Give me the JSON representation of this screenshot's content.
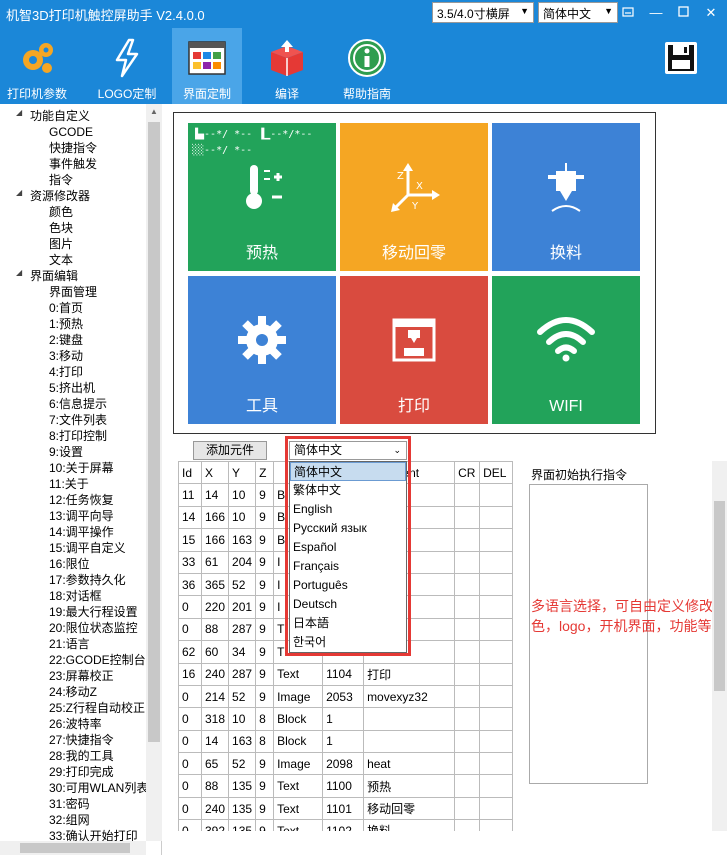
{
  "window": {
    "title": "机智3D打印机触控屏助手 V2.4.0.0",
    "screen_select": "3.5/4.0寸横屏",
    "lang_select": "简体中文",
    "buttons": [
      "minimize",
      "maximize",
      "close"
    ]
  },
  "toolbar": [
    {
      "label": "打印机参数",
      "icon": "gears-icon"
    },
    {
      "label": "LOGO定制",
      "icon": "lightning-icon"
    },
    {
      "label": "界面定制",
      "icon": "layout-icon",
      "active": true
    },
    {
      "label": "编译",
      "icon": "package-icon"
    },
    {
      "label": "帮助指南",
      "icon": "info-icon"
    },
    {
      "label": "",
      "icon": "save-icon"
    }
  ],
  "tree": {
    "items": [
      {
        "label": "功能自定义",
        "level": 1,
        "expander": "◢"
      },
      {
        "label": "GCODE",
        "level": 2
      },
      {
        "label": "快捷指令",
        "level": 2
      },
      {
        "label": "事件触发",
        "level": 2
      },
      {
        "label": "指令",
        "level": 2
      },
      {
        "label": "资源修改器",
        "level": 1,
        "expander": "◢"
      },
      {
        "label": "颜色",
        "level": 2
      },
      {
        "label": "色块",
        "level": 2
      },
      {
        "label": "图片",
        "level": 2
      },
      {
        "label": "文本",
        "level": 2
      },
      {
        "label": "界面编辑",
        "level": 1,
        "expander": "◢"
      },
      {
        "label": "界面管理",
        "level": 2
      },
      {
        "label": "0:首页",
        "level": 2
      },
      {
        "label": "1:预热",
        "level": 2
      },
      {
        "label": "2:键盘",
        "level": 2
      },
      {
        "label": "3:移动",
        "level": 2
      },
      {
        "label": "4:打印",
        "level": 2
      },
      {
        "label": "5:挤出机",
        "level": 2
      },
      {
        "label": "6:信息提示",
        "level": 2
      },
      {
        "label": "7:文件列表",
        "level": 2
      },
      {
        "label": "8:打印控制",
        "level": 2
      },
      {
        "label": "9:设置",
        "level": 2
      },
      {
        "label": "10:关于屏幕",
        "level": 2
      },
      {
        "label": "11:关于",
        "level": 2
      },
      {
        "label": "12:任务恢复",
        "level": 2
      },
      {
        "label": "13:调平向导",
        "level": 2
      },
      {
        "label": "14:调平操作",
        "level": 2
      },
      {
        "label": "15:调平自定义",
        "level": 2
      },
      {
        "label": "16:限位",
        "level": 2
      },
      {
        "label": "17:参数持久化",
        "level": 2
      },
      {
        "label": "18:对话框",
        "level": 2
      },
      {
        "label": "19:最大行程设置",
        "level": 2
      },
      {
        "label": "20:限位状态监控",
        "level": 2
      },
      {
        "label": "21:语言",
        "level": 2
      },
      {
        "label": "22:GCODE控制台",
        "level": 2
      },
      {
        "label": "23:屏幕校正",
        "level": 2
      },
      {
        "label": "24:移动Z",
        "level": 2
      },
      {
        "label": "25:Z行程自动校正",
        "level": 2
      },
      {
        "label": "26:波特率",
        "level": 2
      },
      {
        "label": "27:快捷指令",
        "level": 2
      },
      {
        "label": "28:我的工具",
        "level": 2
      },
      {
        "label": "29:打印完成",
        "level": 2
      },
      {
        "label": "30:可用WLAN列表",
        "level": 2
      },
      {
        "label": "31:密码",
        "level": 2
      },
      {
        "label": "32:组网",
        "level": 2
      },
      {
        "label": "33:确认开始打印",
        "level": 2
      }
    ]
  },
  "preview": {
    "status_line1": "▐▄--*/ *-- ▐▁--*/*--",
    "status_line2": "░░--*/ *--",
    "tiles": [
      {
        "label": "预热",
        "color": "#22a35a",
        "icon": "thermometer-icon"
      },
      {
        "label": "移动回零",
        "color": "#f5a623",
        "icon": "axis-icon"
      },
      {
        "label": "换料",
        "color": "#3d82d6",
        "icon": "extruder-icon"
      },
      {
        "label": "工具",
        "color": "#3d82d6",
        "icon": "gear-icon"
      },
      {
        "label": "打印",
        "color": "#d94b3f",
        "icon": "printer-icon"
      },
      {
        "label": "WIFI",
        "color": "#22a35a",
        "icon": "wifi-icon"
      }
    ]
  },
  "editor": {
    "add_button": "添加元件",
    "lang_selected": "简体中文",
    "lang_options": [
      "简体中文",
      "繁体中文",
      "English",
      "Русский язык",
      "Español",
      "Français",
      "Português",
      "Deutsch",
      "日本語",
      "한국어"
    ],
    "columns": [
      "Id",
      "X",
      "Y",
      "Z",
      "",
      "",
      "Comment",
      "CR",
      "DEL"
    ],
    "rows": [
      [
        "11",
        "14",
        "10",
        "9",
        "B",
        "",
        "",
        "",
        ""
      ],
      [
        "14",
        "166",
        "10",
        "9",
        "B",
        "",
        "",
        "",
        ""
      ],
      [
        "15",
        "166",
        "163",
        "9",
        "B",
        "",
        "",
        "",
        ""
      ],
      [
        "33",
        "61",
        "204",
        "9",
        "I",
        "",
        "ox",
        "",
        ""
      ],
      [
        "36",
        "365",
        "52",
        "9",
        "I",
        "",
        "de",
        "",
        ""
      ],
      [
        "0",
        "220",
        "201",
        "9",
        "I",
        "",
        "",
        "",
        ""
      ],
      [
        "0",
        "88",
        "287",
        "9",
        "T",
        "",
        "",
        "",
        ""
      ],
      [
        "62",
        "60",
        "34",
        "9",
        "T",
        "",
        "",
        "",
        ""
      ],
      [
        "16",
        "240",
        "287",
        "9",
        "Text",
        "1104",
        "打印",
        "",
        ""
      ],
      [
        "0",
        "214",
        "52",
        "9",
        "Image",
        "2053",
        "movexyz32",
        "",
        ""
      ],
      [
        "0",
        "318",
        "10",
        "8",
        "Block",
        "1",
        "",
        "",
        ""
      ],
      [
        "0",
        "14",
        "163",
        "8",
        "Block",
        "1",
        "",
        "",
        ""
      ],
      [
        "0",
        "65",
        "52",
        "9",
        "Image",
        "2098",
        "heat",
        "",
        ""
      ],
      [
        "0",
        "88",
        "135",
        "9",
        "Text",
        "1100",
        "预热",
        "",
        ""
      ],
      [
        "0",
        "240",
        "135",
        "9",
        "Text",
        "1101",
        "移动回零",
        "",
        ""
      ],
      [
        "0",
        "392",
        "135",
        "9",
        "Text",
        "1102",
        "换料",
        "",
        ""
      ]
    ],
    "cmd_label": "界面初始执行指令",
    "note": "多语言选择，可自由定义修改颜色，logo，开机界面，功能等等"
  }
}
